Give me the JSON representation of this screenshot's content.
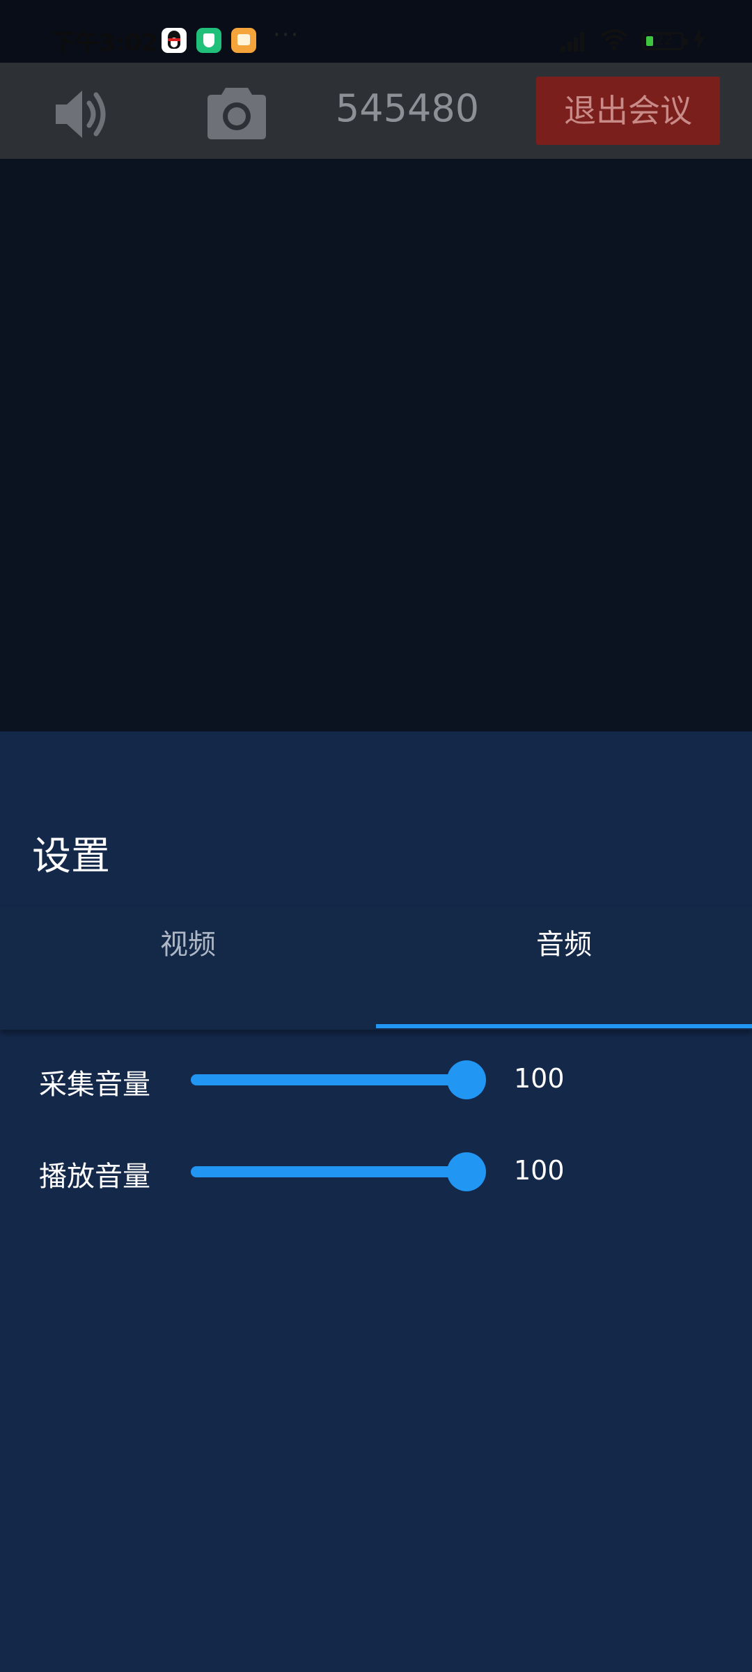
{
  "status_bar": {
    "time": "下午3:02",
    "more": "···",
    "battery_level": "22",
    "icons": [
      "qq-icon",
      "shield-app-icon",
      "notes-app-icon",
      "signal-icon",
      "wifi-icon",
      "battery-icon",
      "charging-icon"
    ]
  },
  "toolbar": {
    "speaker_icon": "speaker-icon",
    "camera_icon": "camera-icon",
    "meeting_id": "545480",
    "exit_label": "退出会议"
  },
  "settings": {
    "title": "设置",
    "tabs": [
      {
        "label": "视频",
        "active": false
      },
      {
        "label": "音频",
        "active": true
      }
    ],
    "audio": {
      "capture": {
        "label": "采集音量",
        "value": 100,
        "value_text": "100",
        "max": 100
      },
      "playback": {
        "label": "播放音量",
        "value": 100,
        "value_text": "100",
        "max": 100
      }
    }
  },
  "colors": {
    "accent": "#2196f3",
    "exit_button": "#7a1f1c",
    "panel_background": "#14284a",
    "toolbar_background": "#2d3035"
  }
}
